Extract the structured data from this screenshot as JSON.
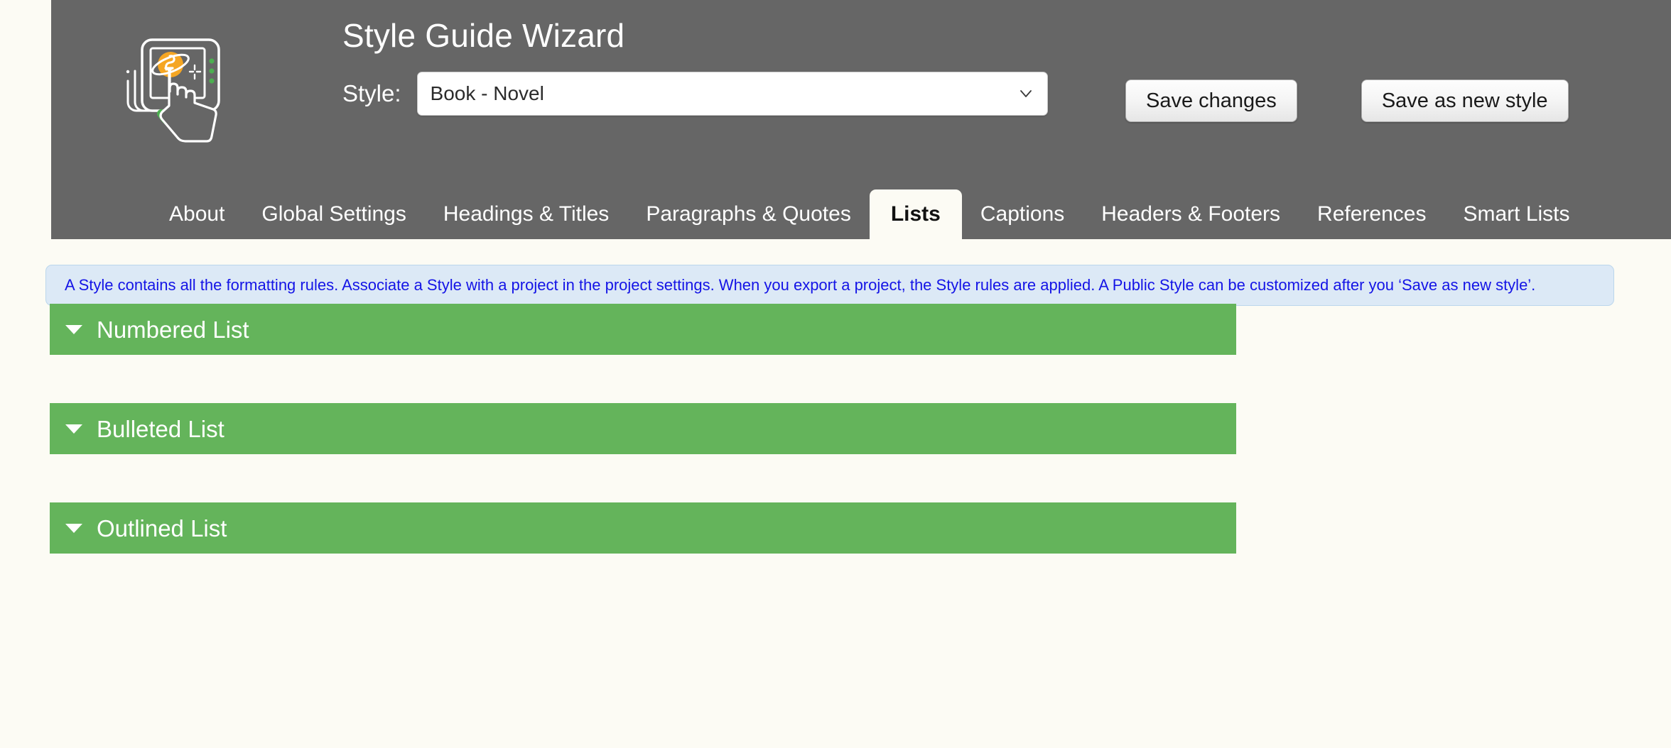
{
  "app": {
    "title": "Style Guide Wizard",
    "background_color": "#FCFBF4",
    "header_color": "#666666",
    "accent_green": "#64B45B",
    "banner_color": "#DCE9F6",
    "banner_text_color": "#1414E6"
  },
  "logo": {
    "name": "tablet-touch-planet-logo",
    "planet_color": "#F5A623",
    "check_color": "#4CAF50",
    "outline_color": "#FFFFFF",
    "dots_color": "#4CAF50"
  },
  "style_selector": {
    "label": "Style:",
    "selected": "Book - Novel",
    "chevron_icon": "chevron-down-icon"
  },
  "toolbar": {
    "save_changes_label": "Save changes",
    "save_as_new_style_label": "Save as new style"
  },
  "tabs": [
    {
      "label": "About",
      "active": false
    },
    {
      "label": "Global Settings",
      "active": false
    },
    {
      "label": "Headings & Titles",
      "active": false
    },
    {
      "label": "Paragraphs & Quotes",
      "active": false
    },
    {
      "label": "Lists",
      "active": true
    },
    {
      "label": "Captions",
      "active": false
    },
    {
      "label": "Headers & Footers",
      "active": false
    },
    {
      "label": "References",
      "active": false
    },
    {
      "label": "Smart Lists",
      "active": false
    }
  ],
  "banner": {
    "text": "A Style contains all the formatting rules. Associate a Style with a project in the project settings. When you export a project, the Style rules are applied. A Public Style can be customized after you ‘Save as new style’."
  },
  "sections": [
    {
      "title": "Numbered List",
      "expanded": false,
      "caret_icon": "caret-down-icon"
    },
    {
      "title": "Bulleted List",
      "expanded": false,
      "caret_icon": "caret-down-icon"
    },
    {
      "title": "Outlined List",
      "expanded": false,
      "caret_icon": "caret-down-icon"
    }
  ]
}
